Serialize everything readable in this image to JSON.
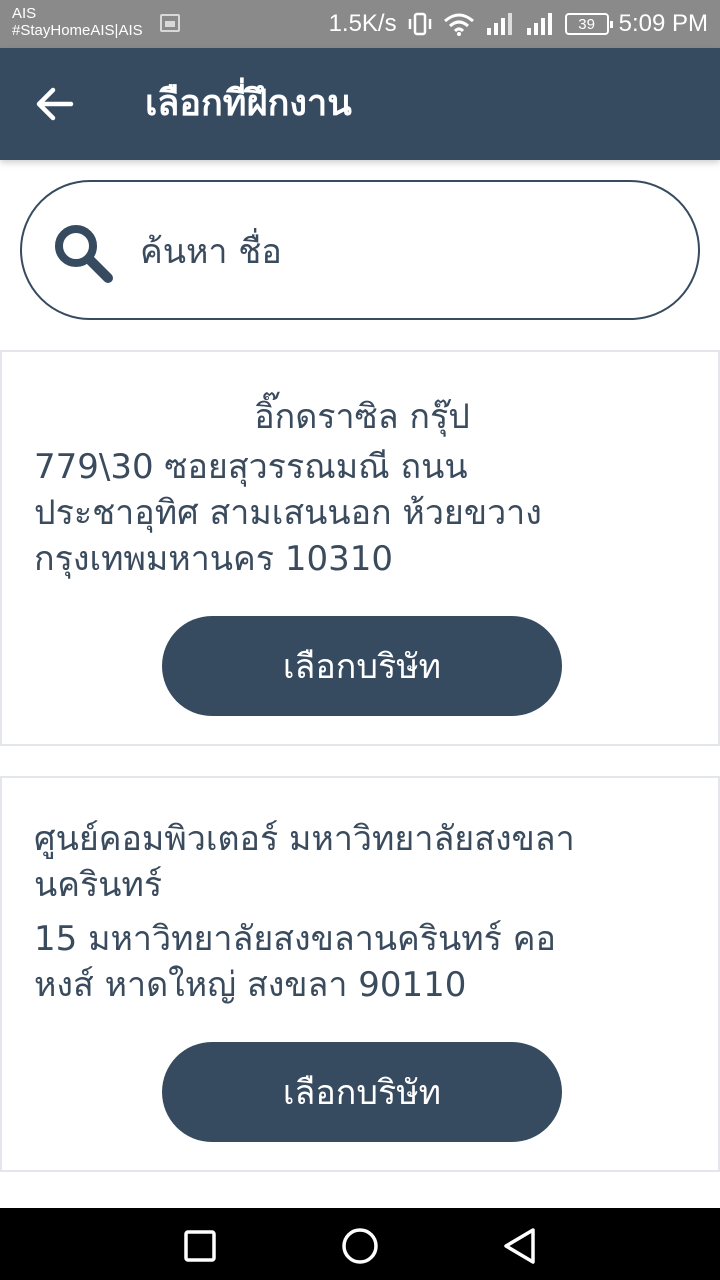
{
  "status_bar": {
    "carrier_line1": "AIS",
    "carrier_line2": "#StayHomeAIS|AIS",
    "speed": "1.5K/s",
    "battery": "39",
    "time": "5:09 PM",
    "icons": [
      "image-icon",
      "vibrate-icon",
      "wifi-icon",
      "signal-icon",
      "signal-icon",
      "battery-icon"
    ]
  },
  "app_bar": {
    "back_icon": "arrow-left-icon",
    "title": "เลือกที่ฝึกงาน",
    "background": "#364a60"
  },
  "search": {
    "icon": "search-icon",
    "value": "",
    "placeholder": "ค้นหา ชื่อ"
  },
  "companies": [
    {
      "name": "อิ๊กดราซิล กรุ๊ป",
      "address_lines": [
        "779\\30 ซอยสุวรรณมณี ถนน",
        "ประชาอุทิศ สามเสนนอก ห้วยขวาง",
        "กรุงเทพมหานคร 10310"
      ],
      "button_label": "เลือกบริษัท"
    },
    {
      "name_lines": [
        "ศูนย์คอมพิวเตอร์ มหาวิทยาลัยสงขลา",
        "นครินทร์"
      ],
      "address_lines": [
        "15 มหาวิทยาลัยสงขลานครินทร์  คอ",
        "หงส์ หาดใหญ่ สงขลา 90110"
      ],
      "button_label": "เลือกบริษัท"
    }
  ],
  "nav_bar": {
    "icons": [
      "recent-apps-icon",
      "home-icon",
      "back-icon"
    ]
  },
  "colors": {
    "primary": "#364a60",
    "text": "#3a4b5e",
    "card_border": "#e3e6ea"
  }
}
